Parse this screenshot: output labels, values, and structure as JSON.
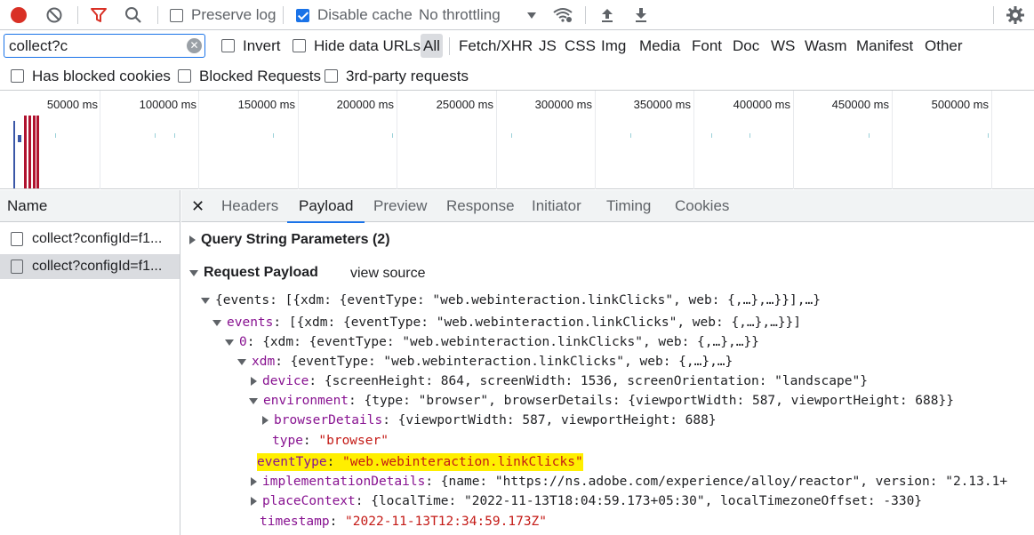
{
  "toolbar": {
    "preserve_log": "Preserve log",
    "disable_cache": "Disable cache",
    "throttling": "No throttling"
  },
  "filter": {
    "value": "collect?c",
    "invert": "Invert",
    "hide_data_urls": "Hide data URLs",
    "types": [
      "All",
      "Fetch/XHR",
      "JS",
      "CSS",
      "Img",
      "Media",
      "Font",
      "Doc",
      "WS",
      "Wasm",
      "Manifest",
      "Other"
    ],
    "has_blocked_cookies": "Has blocked cookies",
    "blocked_requests": "Blocked Requests",
    "third_party": "3rd-party requests"
  },
  "overview": {
    "ticks": [
      "50000 ms",
      "100000 ms",
      "150000 ms",
      "200000 ms",
      "250000 ms",
      "300000 ms",
      "350000 ms",
      "400000 ms",
      "450000 ms",
      "500000 ms"
    ]
  },
  "requests": {
    "header": "Name",
    "items": [
      "collect?configId=f1...",
      "collect?configId=f1..."
    ]
  },
  "detail": {
    "tabs": [
      "Headers",
      "Payload",
      "Preview",
      "Response",
      "Initiator",
      "Timing",
      "Cookies"
    ],
    "query_string": "Query String Parameters (2)",
    "request_payload": "Request Payload",
    "view_source": "view source",
    "lines": {
      "l1": "{events: [{xdm: {eventType: \"web.webinteraction.linkClicks\", web: {,…},…}}],…}",
      "l2_key": "events",
      "l2_val": ": [{xdm: {eventType: \"web.webinteraction.linkClicks\", web: {,…},…}}]",
      "l3_key": "0",
      "l3_val": ": {xdm: {eventType: \"web.webinteraction.linkClicks\", web: {,…},…}}",
      "l4_key": "xdm",
      "l4_val": ": {eventType: \"web.webinteraction.linkClicks\", web: {,…},…}",
      "l5_key": "device",
      "l5_val": ": {screenHeight: 864, screenWidth: 1536, screenOrientation: \"landscape\"}",
      "l6_key": "environment",
      "l6_val": ": {type: \"browser\", browserDetails: {viewportWidth: 587, viewportHeight: 688}}",
      "l7_key": "browserDetails",
      "l7_val": ": {viewportWidth: 587, viewportHeight: 688}",
      "l8_key": "type",
      "l8_val": "\"browser\"",
      "l9_key": "eventType",
      "l9_val": "\"web.webinteraction.linkClicks\"",
      "l10_key": "implementationDetails",
      "l10_val": ": {name: \"https://ns.adobe.com/experience/alloy/reactor\", version: \"2.13.1+",
      "l11_key": "placeContext",
      "l11_val": ": {localTime: \"2022-11-13T18:04:59.173+05:30\", localTimezoneOffset: -330}",
      "l12_key": "timestamp",
      "l12_val": "\"2022-11-13T12:34:59.173Z\""
    }
  }
}
